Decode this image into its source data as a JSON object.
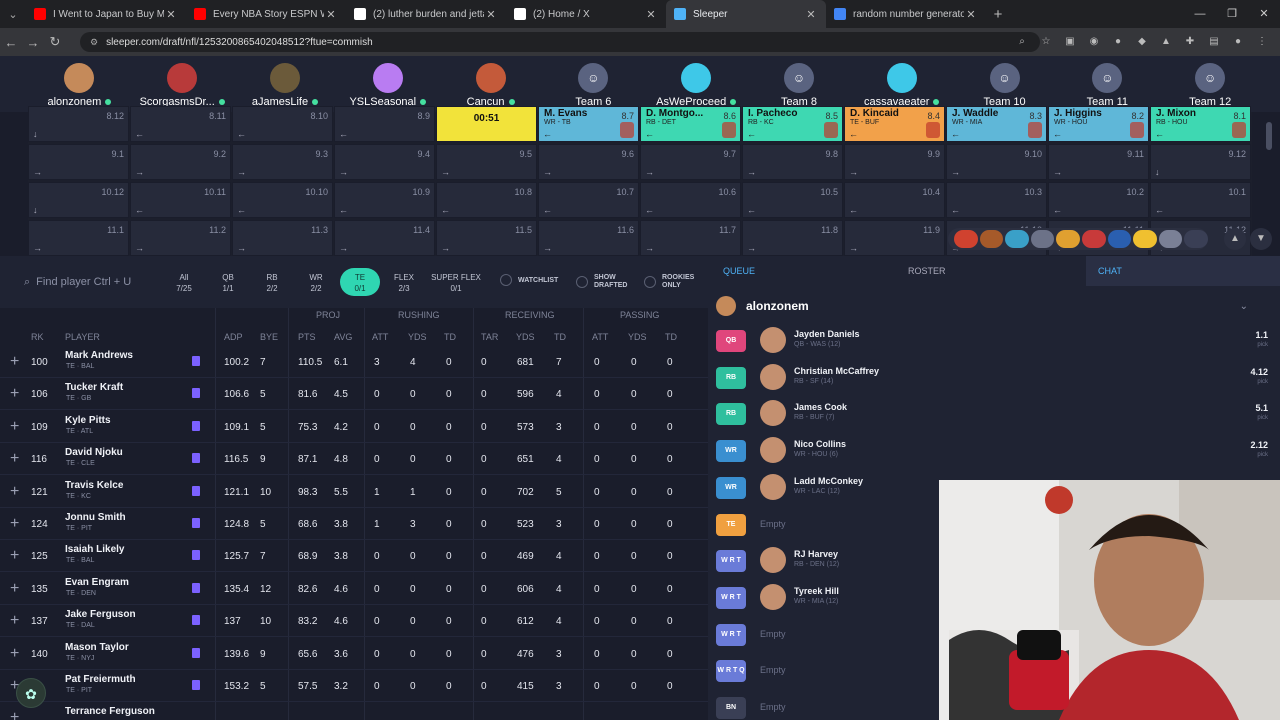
{
  "browser": {
    "tabs": [
      {
        "title": "I Went to Japan to Buy My Ro...",
        "icon": "youtube-icon",
        "color": "#ff0000"
      },
      {
        "title": "Every NBA Story ESPN Was Too ...",
        "icon": "youtube-icon",
        "color": "#ff0000"
      },
      {
        "title": "(2) luther burden and jettas - Se...",
        "icon": "x-icon",
        "color": "#ffffff"
      },
      {
        "title": "(2) Home / X",
        "icon": "x-icon",
        "color": "#ffffff"
      },
      {
        "title": "Sleeper",
        "icon": "sleeper-icon",
        "color": "#4fb3f7"
      },
      {
        "title": "random number generator - Go...",
        "icon": "google-icon",
        "color": "#4285f4"
      }
    ],
    "url": "sleeper.com/draft/nfl/1253200865402048512?ftue=commish"
  },
  "teams": [
    {
      "name": "alonzonem",
      "online": true,
      "color": "#c58a5a"
    },
    {
      "name": "ScorgasmsDr...",
      "online": true,
      "color": "#b83a3a"
    },
    {
      "name": "aJamesLife",
      "online": true,
      "color": "#6b5a3a"
    },
    {
      "name": "YSLSeasonal",
      "online": true,
      "color": "#b97cf2"
    },
    {
      "name": "Cancun",
      "online": true,
      "color": "#c45a3a"
    },
    {
      "name": "Team 6",
      "online": false,
      "color": "#5a6380"
    },
    {
      "name": "AsWeProceed",
      "online": true,
      "color": "#3ec8e8"
    },
    {
      "name": "Team 8",
      "online": false,
      "color": "#5a6380"
    },
    {
      "name": "cassavaeater",
      "online": true,
      "color": "#3ec8e8"
    },
    {
      "name": "Team 10",
      "online": false,
      "color": "#5a6380"
    },
    {
      "name": "Team 11",
      "online": false,
      "color": "#5a6380"
    },
    {
      "name": "Team 12",
      "online": false,
      "color": "#5a6380"
    }
  ],
  "board": {
    "row8": [
      {
        "pick": "8.12"
      },
      {
        "pick": "8.11"
      },
      {
        "pick": "8.10"
      },
      {
        "pick": "8.9"
      },
      {
        "timer": "00:51",
        "color": "#f2e33a"
      },
      {
        "player": "M. Evans",
        "pos": "WR - TB",
        "pick": "8.7",
        "color": "#5fb7d8"
      },
      {
        "player": "D. Montgo...",
        "pos": "RB - DET",
        "pick": "8.6",
        "color": "#3ed8b2"
      },
      {
        "player": "I. Pacheco",
        "pos": "RB - KC",
        "pick": "8.5",
        "color": "#3ed8b2"
      },
      {
        "player": "D. Kincaid",
        "pos": "TE - BUF",
        "pick": "8.4",
        "color": "#f2a14a"
      },
      {
        "player": "J. Waddle",
        "pos": "WR - MIA",
        "pick": "8.3",
        "color": "#5fb7d8"
      },
      {
        "player": "J. Higgins",
        "pos": "WR - HOU",
        "pick": "8.2",
        "color": "#5fb7d8"
      },
      {
        "player": "J. Mixon",
        "pos": "RB - HOU",
        "pick": "8.1",
        "color": "#3ed8b2"
      }
    ],
    "row9": [
      "9.1",
      "9.2",
      "9.3",
      "9.4",
      "9.5",
      "9.6",
      "9.7",
      "9.8",
      "9.9",
      "9.10",
      "9.11",
      "9.12"
    ],
    "row10": [
      "10.12",
      "10.11",
      "10.10",
      "10.9",
      "10.8",
      "10.7",
      "10.6",
      "10.5",
      "10.4",
      "10.3",
      "10.2",
      "10.1"
    ],
    "row11": [
      "11.1",
      "11.2",
      "11.3",
      "11.4",
      "11.5",
      "11.6",
      "11.7",
      "11.8",
      "11.9",
      "11.10",
      "11.11",
      "11.12"
    ]
  },
  "filters": {
    "search_placeholder": "Find player Ctrl + U",
    "positions": [
      {
        "label": "All",
        "count": "7/25"
      },
      {
        "label": "QB",
        "count": "1/1"
      },
      {
        "label": "RB",
        "count": "2/2"
      },
      {
        "label": "WR",
        "count": "2/2"
      },
      {
        "label": "TE",
        "count": "0/1"
      },
      {
        "label": "FLEX",
        "count": "2/3"
      },
      {
        "label": "SUPER FLEX",
        "count": "0/1"
      }
    ],
    "watchlist": "WATCHLIST",
    "show_drafted": "SHOW DRAFTED",
    "rookies_only": "ROOKIES ONLY"
  },
  "table": {
    "groups": {
      "proj": "PROJ",
      "rushing": "RUSHING",
      "receiving": "RECEIVING",
      "passing": "PASSING"
    },
    "headers": {
      "rk": "RK",
      "player": "PLAYER",
      "adp": "ADP",
      "bye": "BYE",
      "pts": "PTS",
      "avg": "AVG",
      "att": "ATT",
      "yds": "YDS",
      "td": "TD",
      "tar": "TAR",
      "ryds": "YDS",
      "rtd": "TD",
      "patt": "ATT",
      "pyds": "YDS",
      "ptd": "TD"
    },
    "rows": [
      {
        "rk": "100",
        "name": "Mark Andrews",
        "pos": "TE · BAL",
        "adp": "100.2",
        "bye": "7",
        "pts": "110.5",
        "avg": "6.1",
        "att": "3",
        "yds": "4",
        "td": "0",
        "tar": "0",
        "ryds": "681",
        "rtd": "7",
        "patt": "0",
        "pyds": "0",
        "ptd": "0"
      },
      {
        "rk": "106",
        "name": "Tucker Kraft",
        "pos": "TE · GB",
        "adp": "106.6",
        "bye": "5",
        "pts": "81.6",
        "avg": "4.5",
        "att": "0",
        "yds": "0",
        "td": "0",
        "tar": "0",
        "ryds": "596",
        "rtd": "4",
        "patt": "0",
        "pyds": "0",
        "ptd": "0"
      },
      {
        "rk": "109",
        "name": "Kyle Pitts",
        "pos": "TE · ATL",
        "adp": "109.1",
        "bye": "5",
        "pts": "75.3",
        "avg": "4.2",
        "att": "0",
        "yds": "0",
        "td": "0",
        "tar": "0",
        "ryds": "573",
        "rtd": "3",
        "patt": "0",
        "pyds": "0",
        "ptd": "0"
      },
      {
        "rk": "116",
        "name": "David Njoku",
        "pos": "TE · CLE",
        "adp": "116.5",
        "bye": "9",
        "pts": "87.1",
        "avg": "4.8",
        "att": "0",
        "yds": "0",
        "td": "0",
        "tar": "0",
        "ryds": "651",
        "rtd": "4",
        "patt": "0",
        "pyds": "0",
        "ptd": "0"
      },
      {
        "rk": "121",
        "name": "Travis Kelce",
        "pos": "TE · KC",
        "adp": "121.1",
        "bye": "10",
        "pts": "98.3",
        "avg": "5.5",
        "att": "1",
        "yds": "1",
        "td": "0",
        "tar": "0",
        "ryds": "702",
        "rtd": "5",
        "patt": "0",
        "pyds": "0",
        "ptd": "0"
      },
      {
        "rk": "124",
        "name": "Jonnu Smith",
        "pos": "TE · PIT",
        "adp": "124.8",
        "bye": "5",
        "pts": "68.6",
        "avg": "3.8",
        "att": "1",
        "yds": "3",
        "td": "0",
        "tar": "0",
        "ryds": "523",
        "rtd": "3",
        "patt": "0",
        "pyds": "0",
        "ptd": "0"
      },
      {
        "rk": "125",
        "name": "Isaiah Likely",
        "pos": "TE · BAL",
        "adp": "125.7",
        "bye": "7",
        "pts": "68.9",
        "avg": "3.8",
        "att": "0",
        "yds": "0",
        "td": "0",
        "tar": "0",
        "ryds": "469",
        "rtd": "4",
        "patt": "0",
        "pyds": "0",
        "ptd": "0"
      },
      {
        "rk": "135",
        "name": "Evan Engram",
        "pos": "TE · DEN",
        "adp": "135.4",
        "bye": "12",
        "pts": "82.6",
        "avg": "4.6",
        "att": "0",
        "yds": "0",
        "td": "0",
        "tar": "0",
        "ryds": "606",
        "rtd": "4",
        "patt": "0",
        "pyds": "0",
        "ptd": "0"
      },
      {
        "rk": "137",
        "name": "Jake Ferguson",
        "pos": "TE · DAL",
        "adp": "137",
        "bye": "10",
        "pts": "83.2",
        "avg": "4.6",
        "att": "0",
        "yds": "0",
        "td": "0",
        "tar": "0",
        "ryds": "612",
        "rtd": "4",
        "patt": "0",
        "pyds": "0",
        "ptd": "0"
      },
      {
        "rk": "140",
        "name": "Mason Taylor",
        "pos": "TE · NYJ",
        "adp": "139.6",
        "bye": "9",
        "pts": "65.6",
        "avg": "3.6",
        "att": "0",
        "yds": "0",
        "td": "0",
        "tar": "0",
        "ryds": "476",
        "rtd": "3",
        "patt": "0",
        "pyds": "0",
        "ptd": "0"
      },
      {
        "rk": "",
        "name": "Pat Freiermuth",
        "pos": "TE · PIT",
        "adp": "153.2",
        "bye": "5",
        "pts": "57.5",
        "avg": "3.2",
        "att": "0",
        "yds": "0",
        "td": "0",
        "tar": "0",
        "ryds": "415",
        "rtd": "3",
        "patt": "0",
        "pyds": "0",
        "ptd": "0"
      },
      {
        "rk": "",
        "name": "Terrance Ferguson",
        "pos": "",
        "adp": "",
        "bye": "",
        "pts": "",
        "avg": "",
        "att": "",
        "yds": "",
        "td": "",
        "tar": "",
        "ryds": "",
        "rtd": "",
        "patt": "",
        "pyds": "",
        "ptd": ""
      }
    ]
  },
  "panel": {
    "tabs": {
      "queue": "QUEUE",
      "roster": "ROSTER",
      "chat": "CHAT"
    },
    "owner": "alonzonem",
    "roster": [
      {
        "slot": "QB",
        "color": "#e0467c",
        "name": "Jayden Daniels",
        "sub": "QB - WAS (12)",
        "pick": "1.1",
        "pick_label": "pick"
      },
      {
        "slot": "RB",
        "color": "#2fbf9e",
        "name": "Christian McCaffrey",
        "sub": "RB - SF (14)",
        "pick": "4.12",
        "pick_label": "pick"
      },
      {
        "slot": "RB",
        "color": "#2fbf9e",
        "name": "James Cook",
        "sub": "RB - BUF (7)",
        "pick": "5.1",
        "pick_label": "pick"
      },
      {
        "slot": "WR",
        "color": "#3a8fd0",
        "name": "Nico Collins",
        "sub": "WR - HOU (6)",
        "pick": "2.12",
        "pick_label": "pick"
      },
      {
        "slot": "WR",
        "color": "#3a8fd0",
        "name": "Ladd McConkey",
        "sub": "WR - LAC (12)",
        "pick": "",
        "pick_label": ""
      },
      {
        "slot": "TE",
        "color": "#f0a040",
        "name": "",
        "sub": "",
        "empty": "Empty"
      },
      {
        "slot": "W R T",
        "color": "#6a7bd8",
        "name": "RJ Harvey",
        "sub": "RB - DEN (12)",
        "pick": "",
        "pick_label": ""
      },
      {
        "slot": "W R T",
        "color": "#6a7bd8",
        "name": "Tyreek Hill",
        "sub": "WR - MIA (12)",
        "pick": "",
        "pick_label": ""
      },
      {
        "slot": "W R T",
        "color": "#6a7bd8",
        "name": "",
        "sub": "",
        "empty": "Empty"
      },
      {
        "slot": "W R T Q",
        "color": "#6a7bd8",
        "name": "",
        "sub": "",
        "empty": "Empty"
      },
      {
        "slot": "BN",
        "color": "#3a3f55",
        "name": "",
        "sub": "",
        "empty": "Empty"
      }
    ]
  }
}
